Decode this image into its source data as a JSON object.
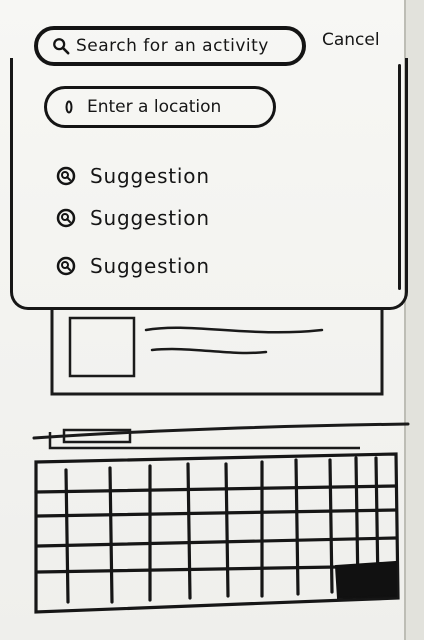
{
  "header": {
    "search_placeholder": "Search for an activity",
    "cancel_label": "Cancel"
  },
  "location": {
    "placeholder": "Enter a location"
  },
  "suggestions": {
    "items": [
      {
        "label": "Suggestion",
        "icon": "search-icon"
      },
      {
        "label": "Suggestion",
        "icon": "search-icon"
      },
      {
        "label": "Suggestion",
        "icon": "search-icon"
      }
    ]
  },
  "colors": {
    "ink": "#141414",
    "paper": "#f5f5f2"
  }
}
